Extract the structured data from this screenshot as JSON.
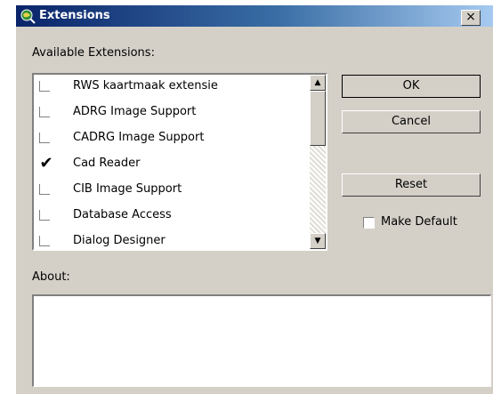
{
  "window": {
    "title": "Extensions",
    "close_glyph": "×"
  },
  "available_label": "Available Extensions:",
  "extensions": [
    {
      "label": "RWS kaartmaak extensie",
      "checked": false
    },
    {
      "label": "ADRG Image Support",
      "checked": false
    },
    {
      "label": "CADRG Image Support",
      "checked": false
    },
    {
      "label": "Cad Reader",
      "checked": true
    },
    {
      "label": "CIB Image Support",
      "checked": false
    },
    {
      "label": "Database Access",
      "checked": false
    },
    {
      "label": "Dialog Designer",
      "checked": false
    }
  ],
  "buttons": {
    "ok": "OK",
    "cancel": "Cancel",
    "reset": "Reset"
  },
  "make_default": {
    "label": "Make Default",
    "checked": false
  },
  "about_label": "About:",
  "about_text": "",
  "icons": {
    "app": "arcview-globe-icon",
    "scroll_up": "scroll-up-arrow-icon",
    "scroll_down": "scroll-down-arrow-icon"
  },
  "colors": {
    "face": "#d4d0c8",
    "title_start": "#0a246a",
    "title_end": "#a6caf0"
  }
}
